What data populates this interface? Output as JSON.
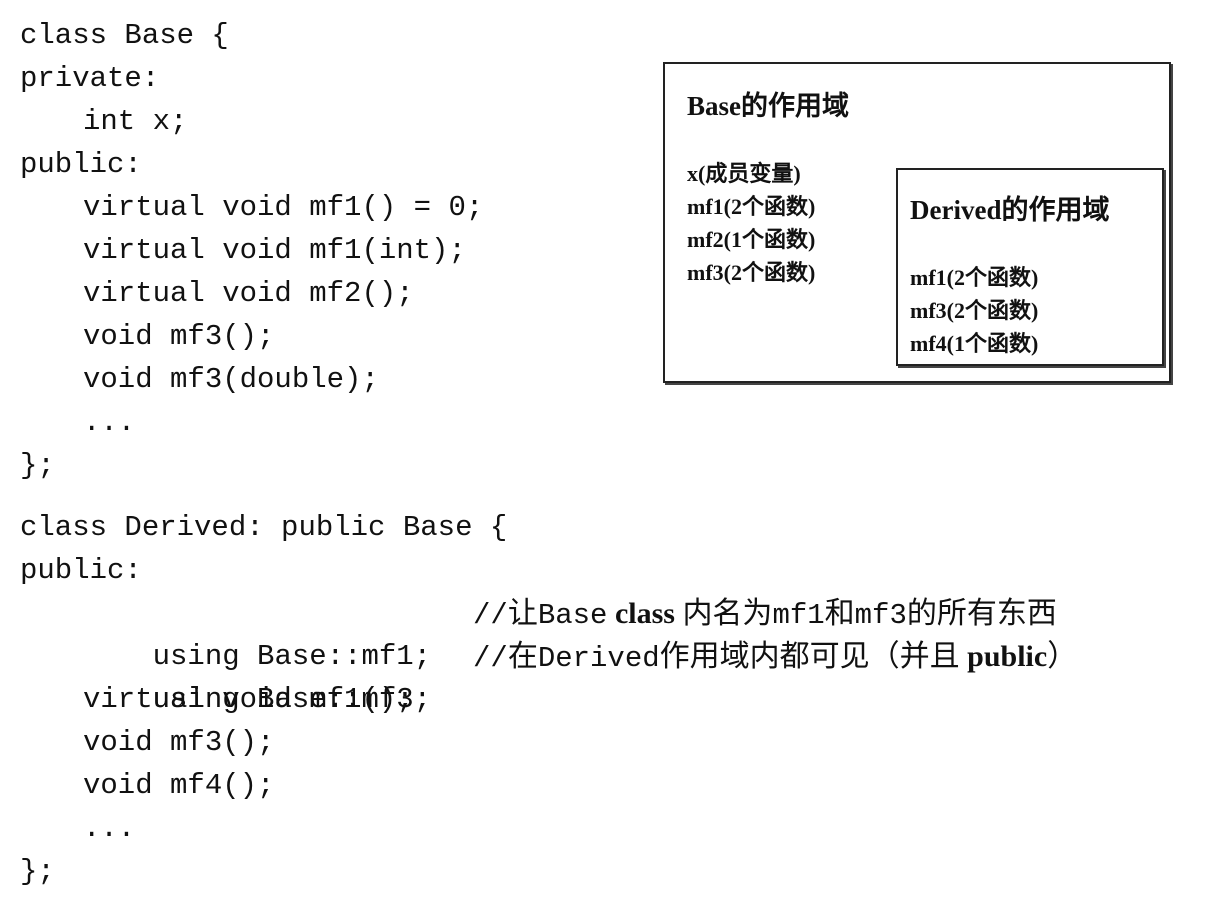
{
  "base_code": {
    "lines": [
      "class Base {",
      "private:",
      "int x;",
      "public:",
      "virtual void mf1() = 0;",
      "virtual void mf1(int);",
      "virtual void mf2();",
      "void mf3();",
      "void mf3(double);",
      "...",
      "};"
    ]
  },
  "derived_code": {
    "lines": [
      "class Derived: public Base {",
      "public:",
      "using Base::mf1;",
      "using Base::mf3;",
      "virtual void mf1();",
      "void mf3();",
      "void mf4();",
      "...",
      "};"
    ],
    "comments": {
      "line1": {
        "prefix": "//",
        "t1": "让",
        "t2": "Base",
        "t3": " class",
        "t4": " 内名为",
        "t5": "mf1",
        "t6": "和",
        "t7": "mf3",
        "t8": "的所有东西"
      },
      "line2": {
        "prefix": "//",
        "t1": "在",
        "t2": "Derived",
        "t3": "作用域内都可见（并且",
        "t4": " public",
        "t5": "）"
      }
    }
  },
  "scope_diagram": {
    "base_scope": {
      "title": "Base的作用域",
      "items": [
        "x(成员变量)",
        "mf1(2个函数)",
        "mf2(1个函数)",
        "mf3(2个函数)"
      ]
    },
    "derived_scope": {
      "title": "Derived的作用域",
      "items": [
        "mf1(2个函数)",
        "mf3(2个函数)",
        "mf4(1个函数)"
      ]
    }
  }
}
